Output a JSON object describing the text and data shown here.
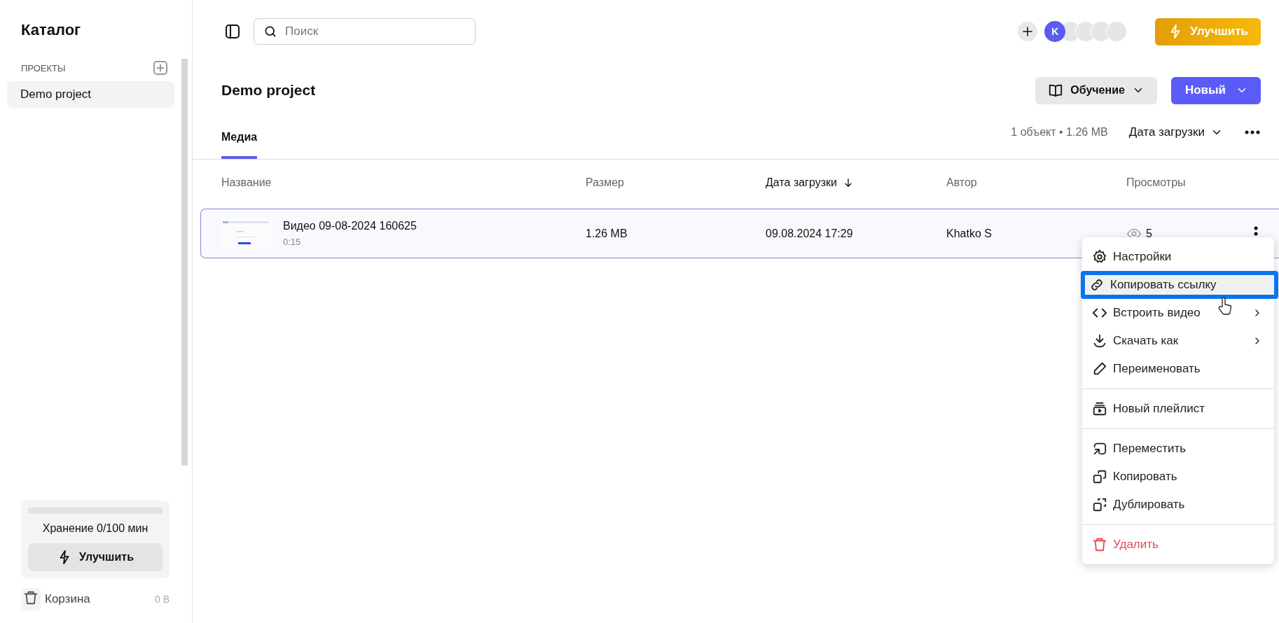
{
  "sidebar": {
    "title": "Каталог",
    "section_label": "ПРОЕКТЫ",
    "projects": [
      {
        "label": "Demo project",
        "selected": true
      }
    ],
    "storage": {
      "level": 0,
      "label": "Хранение 0/100 мин",
      "upgrade_button": "Улучшить"
    },
    "trash": {
      "label": "Корзина",
      "size": "0 B"
    }
  },
  "topbar": {
    "search_placeholder": "Поиск",
    "avatars": [
      {
        "initial": "K"
      }
    ],
    "upgrade_button": "Улучшить"
  },
  "project": {
    "title": "Demo project",
    "learn_button": "Обучение",
    "new_button": "Новый"
  },
  "tabs": [
    {
      "label": "Медиа",
      "selected": true
    }
  ],
  "summary": "1 объект • 1.26 MB",
  "sort_label": "Дата загрузки",
  "table": {
    "columns": [
      {
        "label": "Название",
        "sorted": false
      },
      {
        "label": "Размер",
        "sorted": false
      },
      {
        "label": "Дата загрузки",
        "sorted": true
      },
      {
        "label": "Автор",
        "sorted": false
      },
      {
        "label": "Просмотры",
        "sorted": false
      }
    ],
    "rows": [
      {
        "name": "Видео 09-08-2024 160625",
        "duration": "0:15",
        "size": "1.26 MB",
        "uploaded": "09.08.2024 17:29",
        "author": "Khatko S",
        "views": "5",
        "selected": true
      }
    ]
  },
  "context_menu": {
    "groups": [
      [
        {
          "label": "Настройки",
          "kind": "normal",
          "selected": false,
          "submenu": false
        },
        {
          "label": "Копировать ссылку",
          "kind": "normal",
          "selected": true,
          "submenu": false
        },
        {
          "label": "Встроить видео",
          "kind": "normal",
          "selected": false,
          "submenu": true
        },
        {
          "label": "Скачать как",
          "kind": "normal",
          "selected": false,
          "submenu": true
        },
        {
          "label": "Переименовать",
          "kind": "normal",
          "selected": false,
          "submenu": false
        }
      ],
      [
        {
          "label": "Новый плейлист",
          "kind": "normal",
          "selected": false,
          "submenu": false
        }
      ],
      [
        {
          "label": "Переместить",
          "kind": "normal",
          "selected": false,
          "submenu": false
        },
        {
          "label": "Копировать",
          "kind": "normal",
          "selected": false,
          "submenu": false
        },
        {
          "label": "Дублировать",
          "kind": "normal",
          "selected": false,
          "submenu": false
        }
      ],
      [
        {
          "label": "Удалить",
          "kind": "danger",
          "selected": false,
          "submenu": false
        }
      ]
    ]
  }
}
